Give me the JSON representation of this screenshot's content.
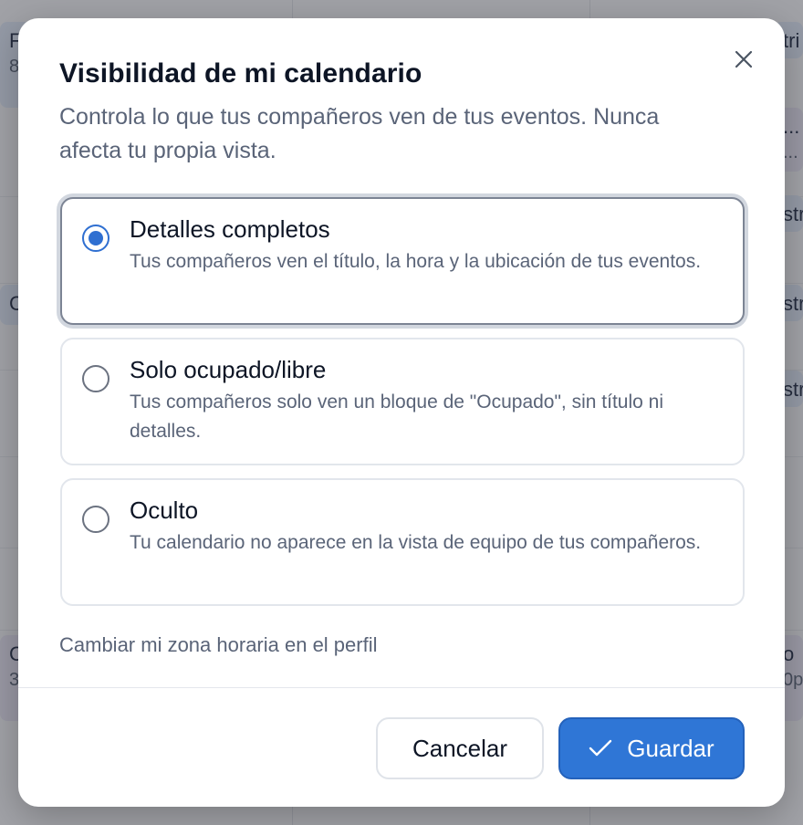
{
  "background": {
    "events": [
      {
        "title": "F",
        "sub": "8"
      },
      {
        "title": "tri",
        "sub": ""
      },
      {
        "title": "...",
        "sub": "..."
      },
      {
        "title": "str",
        "sub": ""
      },
      {
        "title": "C",
        "sub": ""
      },
      {
        "title": "str",
        "sub": ""
      },
      {
        "title": "str",
        "sub": ""
      },
      {
        "title": "C",
        "sub": "3"
      },
      {
        "title": "o",
        "sub": "0p"
      }
    ]
  },
  "modal": {
    "title": "Visibilidad de mi calendario",
    "description": "Controla lo que tus compañeros ven de tus eventos. Nunca afecta tu propia vista.",
    "close_icon": "close-icon",
    "options": [
      {
        "title": "Detalles completos",
        "description": "Tus compañeros ven el título, la hora y la ubicación de tus eventos.",
        "selected": true
      },
      {
        "title": "Solo ocupado/libre",
        "description": "Tus compañeros solo ven un bloque de \"Ocupado\", sin título ni detalles.",
        "selected": false
      },
      {
        "title": "Oculto",
        "description": "Tu calendario no aparece en la vista de equipo de tus compañeros.",
        "selected": false
      }
    ],
    "timezone_link": "Cambiar mi zona horaria en el perfil",
    "cancel_label": "Cancelar",
    "save_label": "Guardar",
    "save_icon": "check-icon"
  },
  "colors": {
    "accent": "#2f76d6",
    "title_text": "#0d1525",
    "muted_text": "#5a6478"
  }
}
